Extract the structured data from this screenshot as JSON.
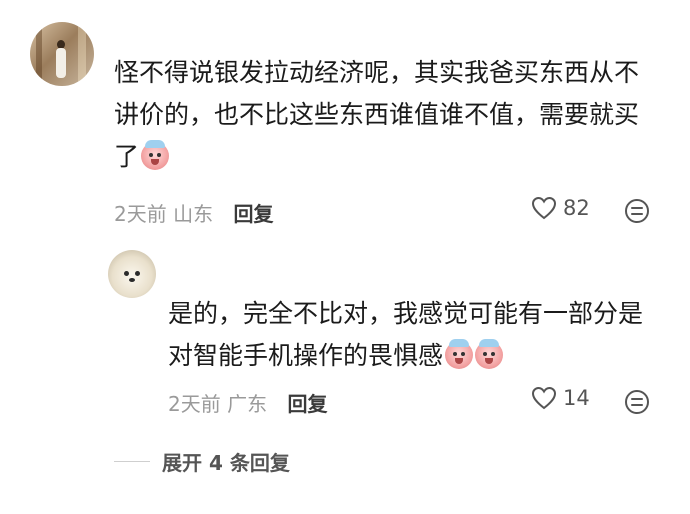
{
  "comment": {
    "text_line1": "怪不得说银发拉动经济呢，其实我爸买东西从不",
    "text_line2": "讲价的，也不比这些东西谁值谁不值，需要就买",
    "text_line3": "了",
    "time": "2天前",
    "location": "山东",
    "reply_label": "回复",
    "likes": "82",
    "emoji": "crying-baby-emoji"
  },
  "reply": {
    "text_line1": "是的，完全不比对，我感觉可能有一部分是",
    "text_line2": "对智能手机操作的畏惧感",
    "time": "2天前",
    "location": "广东",
    "reply_label": "回复",
    "likes": "14",
    "emoji": "sweat-baby-emoji"
  },
  "expand_label": "展开 4 条回复",
  "colors": {
    "meta": "#9a9a9a",
    "text": "#1b1b1b",
    "icon": "#555555"
  }
}
